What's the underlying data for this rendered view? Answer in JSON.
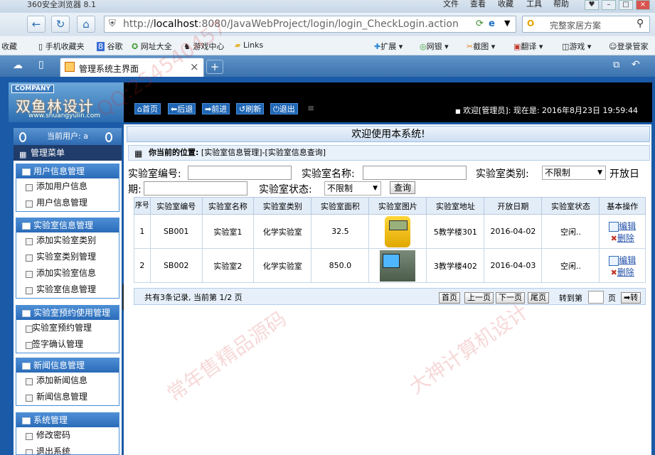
{
  "browser": {
    "title": "360安全浏览器 8.1",
    "menus": [
      "文件",
      "查看",
      "收藏",
      "工具",
      "帮助"
    ],
    "url_host": "localhost",
    "url_rest": ":8080/JavaWebProject/login/login_CheckLogin.action",
    "url_prefix": "http://",
    "search_placeholder": "完整家居方案",
    "bookmarks": [
      "收藏",
      "手机收藏夹",
      "谷歌",
      "网址大全",
      "游戏中心",
      "Links"
    ],
    "tools": [
      "扩展",
      "网银",
      "截图",
      "翻译",
      "游戏",
      "登录管家"
    ],
    "tab_title": "管理系统主界面",
    "tab_close": "×",
    "new_tab": "+"
  },
  "header": {
    "company": "COMPANY",
    "brand": "双鱼林设计",
    "brand_url": "www.shuangyulin.com",
    "buttons": [
      "首页",
      "后退",
      "前进",
      "刷新",
      "退出"
    ],
    "welcome": "欢迎[管理员]:  现在是: 2016年8月23日 19:59:44"
  },
  "sidebar": {
    "current_user": "当前用户: a",
    "main_menu": "管理菜单",
    "groups": [
      {
        "title": "用户信息管理",
        "items": [
          "添加用户信息",
          "用户信息管理"
        ]
      },
      {
        "title": "实验室信息管理",
        "items": [
          "添加实验室类别",
          "实验室类别管理",
          "添加实验室信息",
          "实验室信息管理"
        ]
      },
      {
        "title": "实验室预约使用管理",
        "items": [
          "实验室预约管理",
          "签字确认管理"
        ]
      },
      {
        "title": "新闻信息管理",
        "items": [
          "添加新闻信息",
          "新闻信息管理"
        ]
      },
      {
        "title": "系统管理",
        "items": [
          "修改密码",
          "退出系统"
        ]
      }
    ]
  },
  "main": {
    "title": "欢迎使用本系统!",
    "crumb_label": "你当前的位置:",
    "crumb_path": "[实验室信息管理]-[实验室信息查询]",
    "form": {
      "lab_no_label": "实验室编号:",
      "lab_name_label": "实验室名称:",
      "lab_type_label": "实验室类别:",
      "lab_type_value": "不限制",
      "open_date_label_1": "开放日",
      "open_date_label_2": "期:",
      "lab_status_label": "实验室状态:",
      "lab_status_value": "不限制",
      "query_button": "查询"
    },
    "table": {
      "headers": [
        "序号",
        "实验室编号",
        "实验室名称",
        "实验室类别",
        "实验室面积",
        "实验室图片",
        "实验室地址",
        "开放日期",
        "实验室状态",
        "基本操作"
      ],
      "rows": [
        {
          "no": "1",
          "code": "SB001",
          "name": "实验室1",
          "type": "化学实验室",
          "area": "32.5",
          "address": "5教学楼301",
          "date": "2016-04-02",
          "status": "空闲..",
          "edit": "编辑",
          "delete": "删除"
        },
        {
          "no": "2",
          "code": "SB002",
          "name": "实验室2",
          "type": "化学实验室",
          "area": "850.0",
          "address": "3教学楼402",
          "date": "2016-04-03",
          "status": "空闲..",
          "edit": "编辑",
          "delete": "删除"
        }
      ]
    },
    "pager": {
      "summary": "共有3条记录, 当前第 1/2 页",
      "first": "首页",
      "prev": "上一页",
      "next": "下一页",
      "last": "尾页",
      "goto_label": "转到第",
      "page_unit": "页",
      "goto_button": "➡转"
    }
  },
  "watermarks": [
    "QQ:254540457",
    "常年售精品源码",
    "大神计算机设计"
  ]
}
